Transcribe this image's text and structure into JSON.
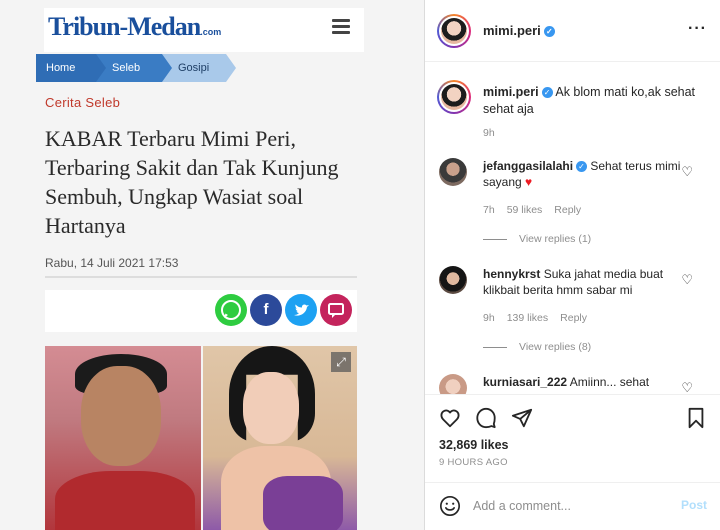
{
  "article": {
    "logo": "Tribun-Medan",
    "logo_suffix": ".com",
    "breadcrumbs": [
      "Home",
      "Seleb",
      "Gosipi"
    ],
    "category": "Cerita Seleb",
    "headline": "KABAR Terbaru Mimi Peri, Terbaring Sakit dan Tak Kunjung Sembuh, Ungkap Wasiat soal Hartanya",
    "date": "Rabu, 14 Juli 2021 17:53",
    "share_icons": [
      "whatsapp-icon",
      "facebook-icon",
      "twitter-icon",
      "comment-icon"
    ],
    "expand_icon": "⤢"
  },
  "instagram": {
    "header_username": "mimi.peri",
    "caption": {
      "username": "mimi.peri",
      "text": "Ak blom mati ko,ak sehat sehat aja",
      "time": "9h"
    },
    "comments": [
      {
        "username": "jefanggasilalahi",
        "verified": true,
        "text": "Sehat terus mimi sayang",
        "emoji": "♥",
        "time": "7h",
        "likes": "59 likes",
        "reply": "Reply",
        "view_replies": "View replies (1)"
      },
      {
        "username": "hennykrst",
        "verified": false,
        "text": "Suka jahat media buat klikbait berita hmm sabar mi",
        "time": "9h",
        "likes": "139 likes",
        "reply": "Reply",
        "view_replies": "View replies (8)"
      },
      {
        "username": "kurniasari_222",
        "verified": false,
        "text": "Amiinn... sehat"
      }
    ],
    "likes": "32,869 likes",
    "time_ago": "9 HOURS AGO",
    "add_comment_placeholder": "Add a comment...",
    "post_label": "Post",
    "colors": {
      "verified": "#3897f0",
      "post_disabled": "#b2dffc",
      "heart_red": "#ed1c24"
    }
  }
}
